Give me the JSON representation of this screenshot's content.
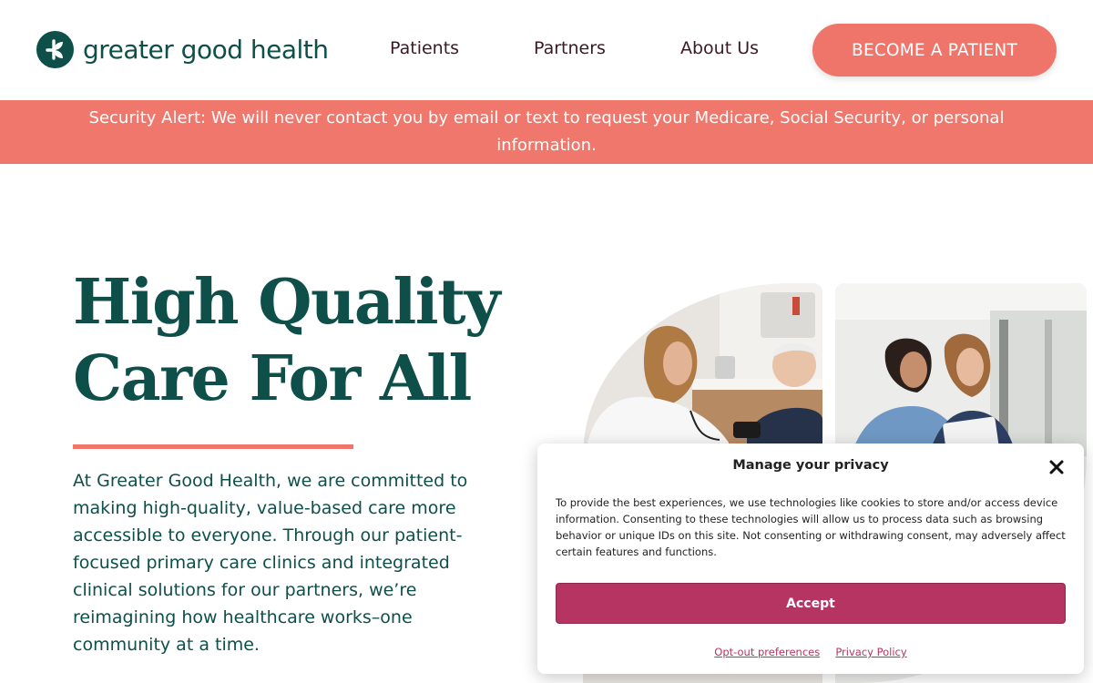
{
  "brand": {
    "name": "greater good health",
    "color": "#0e4f4a",
    "accent": "#ef756b"
  },
  "nav": {
    "items": [
      {
        "label": "Patients"
      },
      {
        "label": "Partners"
      },
      {
        "label": "About Us"
      }
    ],
    "cta_label": "BECOME A PATIENT"
  },
  "alert": {
    "text": "Security Alert: We will never contact you by email or text to request your Medicare, Social Security, or personal information."
  },
  "hero": {
    "title_line1": "High Quality",
    "title_line2": "Care For All",
    "body": "At Greater Good Health, we are committed to making high-quality, value-based care more accessible to everyone. Through our patient-focused primary care clinics and integrated clinical solutions for our partners, we’re reimagining how healthcare works–one community at a time."
  },
  "privacy": {
    "title": "Manage your privacy",
    "text": "To provide the best experiences, we use technologies like cookies to store and/or access device information. Consenting to these technologies will allow us to process data such as browsing behavior or unique IDs on this site. Not consenting or withdrawing consent, may adversely affect certain features and functions.",
    "accept_label": "Accept",
    "links": [
      "Opt-out preferences",
      "Privacy Policy"
    ],
    "accept_color": "#b63462"
  }
}
